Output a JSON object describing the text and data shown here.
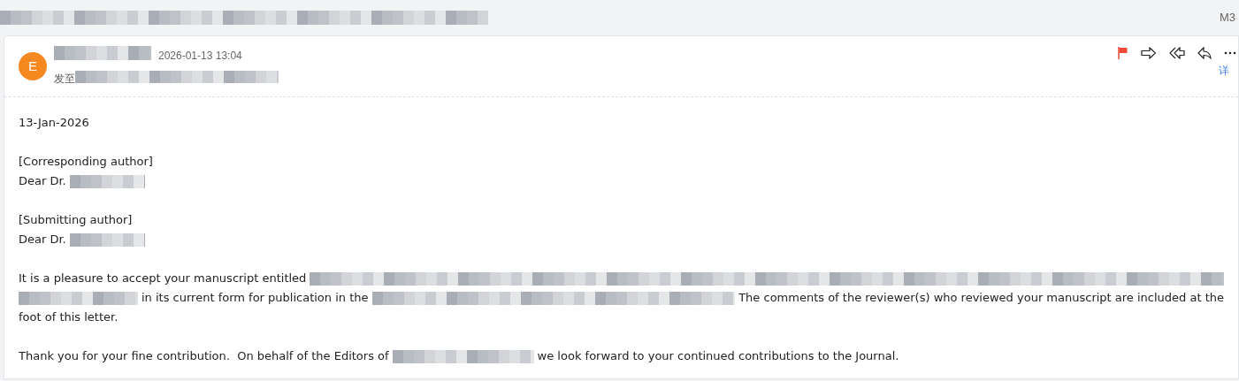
{
  "subject_bar": {
    "subject": {
      "kind": "redacted"
    },
    "folder_label": "M3"
  },
  "message": {
    "avatar_letter": "E",
    "sender": {
      "kind": "redacted"
    },
    "date": "2026-01-13 13:04",
    "to_label": "发至",
    "recipients": {
      "kind": "redacted"
    },
    "flagged": true,
    "details_link": "详"
  },
  "body": [
    [
      [
        {
          "kind": "text",
          "text": "13-Jan-2026"
        }
      ]
    ],
    [
      [
        {
          "kind": "text",
          "text": "[Corresponding author]"
        }
      ],
      [
        {
          "kind": "text",
          "text": "Dear Dr."
        },
        {
          "kind": "redacted"
        }
      ]
    ],
    [
      [
        {
          "kind": "text",
          "text": "[Submitting author]"
        }
      ],
      [
        {
          "kind": "text",
          "text": "Dear Dr."
        },
        {
          "kind": "redacted"
        }
      ]
    ],
    [
      [
        {
          "kind": "text",
          "text": "It is a pleasure to accept your manuscript entitled"
        },
        {
          "kind": "redacted"
        }
      ],
      [
        {
          "kind": "redacted"
        },
        {
          "kind": "text",
          "text": "in its current form for publication in the"
        },
        {
          "kind": "redacted"
        },
        {
          "kind": "text",
          "text": "The comments of the reviewer(s) who reviewed your manuscript are included at the"
        }
      ],
      [
        {
          "kind": "text",
          "text": "foot of this letter."
        }
      ]
    ],
    [
      [
        {
          "kind": "text",
          "text": "Thank you for your fine contribution.  On behalf of the Editors of"
        },
        {
          "kind": "redacted"
        },
        {
          "kind": "text",
          "text": "we look forward to your continued contributions to the Journal."
        }
      ]
    ]
  ]
}
